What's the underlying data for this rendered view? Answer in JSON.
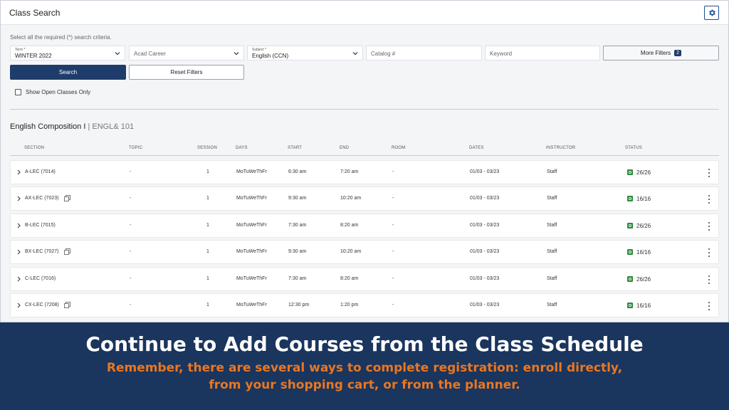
{
  "header": {
    "title": "Class Search"
  },
  "instructions": "Select all the required (*) search criteria.",
  "filters": {
    "term": {
      "label": "Term *",
      "value": "WINTER 2022"
    },
    "career": {
      "placeholder": "Acad Career"
    },
    "subject": {
      "label": "Subject *",
      "value": "English (CCN)"
    },
    "catalog": {
      "placeholder": "Catalog #"
    },
    "keyword": {
      "placeholder": "Keyword"
    },
    "more_label": "More Filters",
    "more_count": "2",
    "search_label": "Search",
    "reset_label": "Reset Filters",
    "open_only_label": "Show Open Classes Only"
  },
  "course": {
    "name": "English Composition I",
    "separator": " | ",
    "code": "ENGL& 101"
  },
  "columns": {
    "section": "SECTION",
    "topic": "TOPIC",
    "session": "SESSION",
    "days": "DAYS",
    "start": "START",
    "end": "END",
    "room": "ROOM",
    "dates": "DATES",
    "instructor": "INSTRUCTOR",
    "status": "STATUS"
  },
  "rows": [
    {
      "section": "A-LEC (7014)",
      "topic": "-",
      "session": "1",
      "days": "MoTuWeThFr",
      "start": "6:30 am",
      "end": "7:20 am",
      "room": "-",
      "dates": "01/03 - 03/23",
      "instructor": "Staff",
      "status": "26/26"
    },
    {
      "section": "AX-LEC (7023)",
      "topic": "-",
      "session": "1",
      "days": "MoTuWeThFr",
      "start": "9:30 am",
      "end": "10:20 am",
      "room": "-",
      "dates": "01/03 - 03/23",
      "instructor": "Staff",
      "status": "16/16"
    },
    {
      "section": "B-LEC (7015)",
      "topic": "-",
      "session": "1",
      "days": "MoTuWeThFr",
      "start": "7:30 am",
      "end": "8:20 am",
      "room": "-",
      "dates": "01/03 - 03/23",
      "instructor": "Staff",
      "status": "26/26"
    },
    {
      "section": "BX-LEC (7027)",
      "topic": "-",
      "session": "1",
      "days": "MoTuWeThFr",
      "start": "9:30 am",
      "end": "10:20 am",
      "room": "-",
      "dates": "01/03 - 03/23",
      "instructor": "Staff",
      "status": "16/16"
    },
    {
      "section": "C-LEC (7016)",
      "topic": "-",
      "session": "1",
      "days": "MoTuWeThFr",
      "start": "7:30 am",
      "end": "8:20 am",
      "room": "-",
      "dates": "01/03 - 03/23",
      "instructor": "Staff",
      "status": "26/26"
    },
    {
      "section": "CX-LEC (7208)",
      "topic": "-",
      "session": "1",
      "days": "MoTuWeThFr",
      "start": "12:30 pm",
      "end": "1:20 pm",
      "room": "-",
      "dates": "01/03 - 03/23",
      "instructor": "Staff",
      "status": "16/16"
    }
  ],
  "banner": {
    "title": "Continue to Add Courses from the Class Schedule",
    "line1": "Remember, there are several ways to complete registration: enroll directly,",
    "line2": "from your shopping cart, or from the planner."
  },
  "colors": {
    "primary": "#1f3d6b",
    "banner_bg": "#1a355e",
    "banner_accent": "#e87722",
    "status_open": "#2e8b3d"
  },
  "icons": {
    "settings": "gear-icon",
    "dropdown": "chevron-down-icon",
    "expand": "chevron-right-icon",
    "combined": "copy-icon",
    "status": "open-status-icon",
    "row_menu": "more-vertical-icon"
  }
}
